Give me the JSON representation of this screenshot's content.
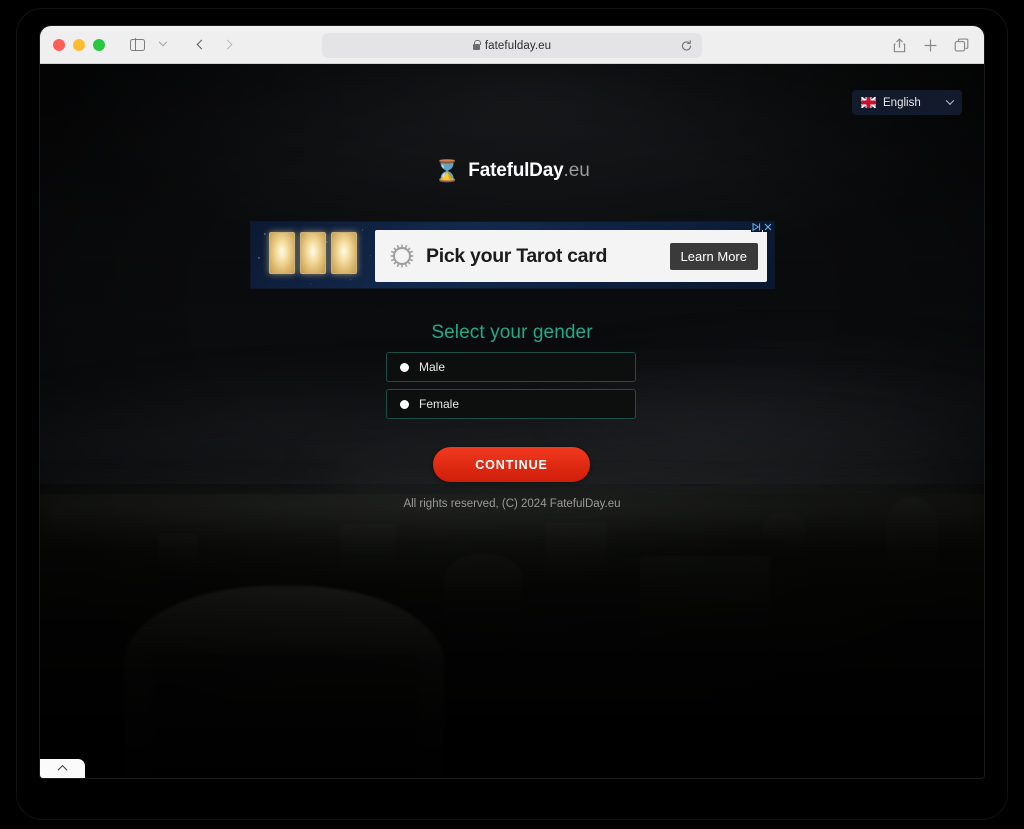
{
  "browser": {
    "traffic_lights": [
      "close",
      "minimize",
      "maximize"
    ],
    "sidebar_toggle_icon": "sidebar-icon",
    "tab_overview_chevron_icon": "chevron-down-icon",
    "back_icon": "chevron-left-icon",
    "forward_icon": "chevron-right-icon",
    "url": "fatefulday.eu",
    "lock_icon": "lock-icon",
    "reload_icon": "reload-icon",
    "share_icon": "share-icon",
    "new_tab_icon": "plus-icon",
    "tabs_icon": "tabs-overview-icon"
  },
  "page": {
    "language_selector": {
      "flag_icon": "uk-flag-icon",
      "label": "English",
      "chevron_icon": "chevron-down-icon"
    },
    "logo": {
      "hourglass_icon": "⌛",
      "name": "FatefulDay",
      "tld": ".eu"
    },
    "ad": {
      "adchoices_icon": "adchoices-icon",
      "close_icon": "close-icon",
      "gear_icon": "sunburst-gear-icon",
      "headline": "Pick your Tarot card",
      "cta_label": "Learn More",
      "card_count": 3
    },
    "form": {
      "heading": "Select your gender",
      "options": [
        {
          "label": "Male",
          "value": "male"
        },
        {
          "label": "Female",
          "value": "female"
        }
      ],
      "submit_label": "CONTINUE"
    },
    "footer": "All rights reserved, (C) 2024 FatefulDay.eu",
    "bottom_tab_icon": "chevron-up-icon"
  },
  "colors": {
    "page_background": "#050505",
    "heading_teal": "#22a98a",
    "option_border": "#1d4f44",
    "continue_red": "#e02a12",
    "lang_button_navy": "#121a2c",
    "footer_gray": "#9a9a9a",
    "toolbar_gray": "#f0eff0",
    "ad_blue": "#13294d"
  }
}
